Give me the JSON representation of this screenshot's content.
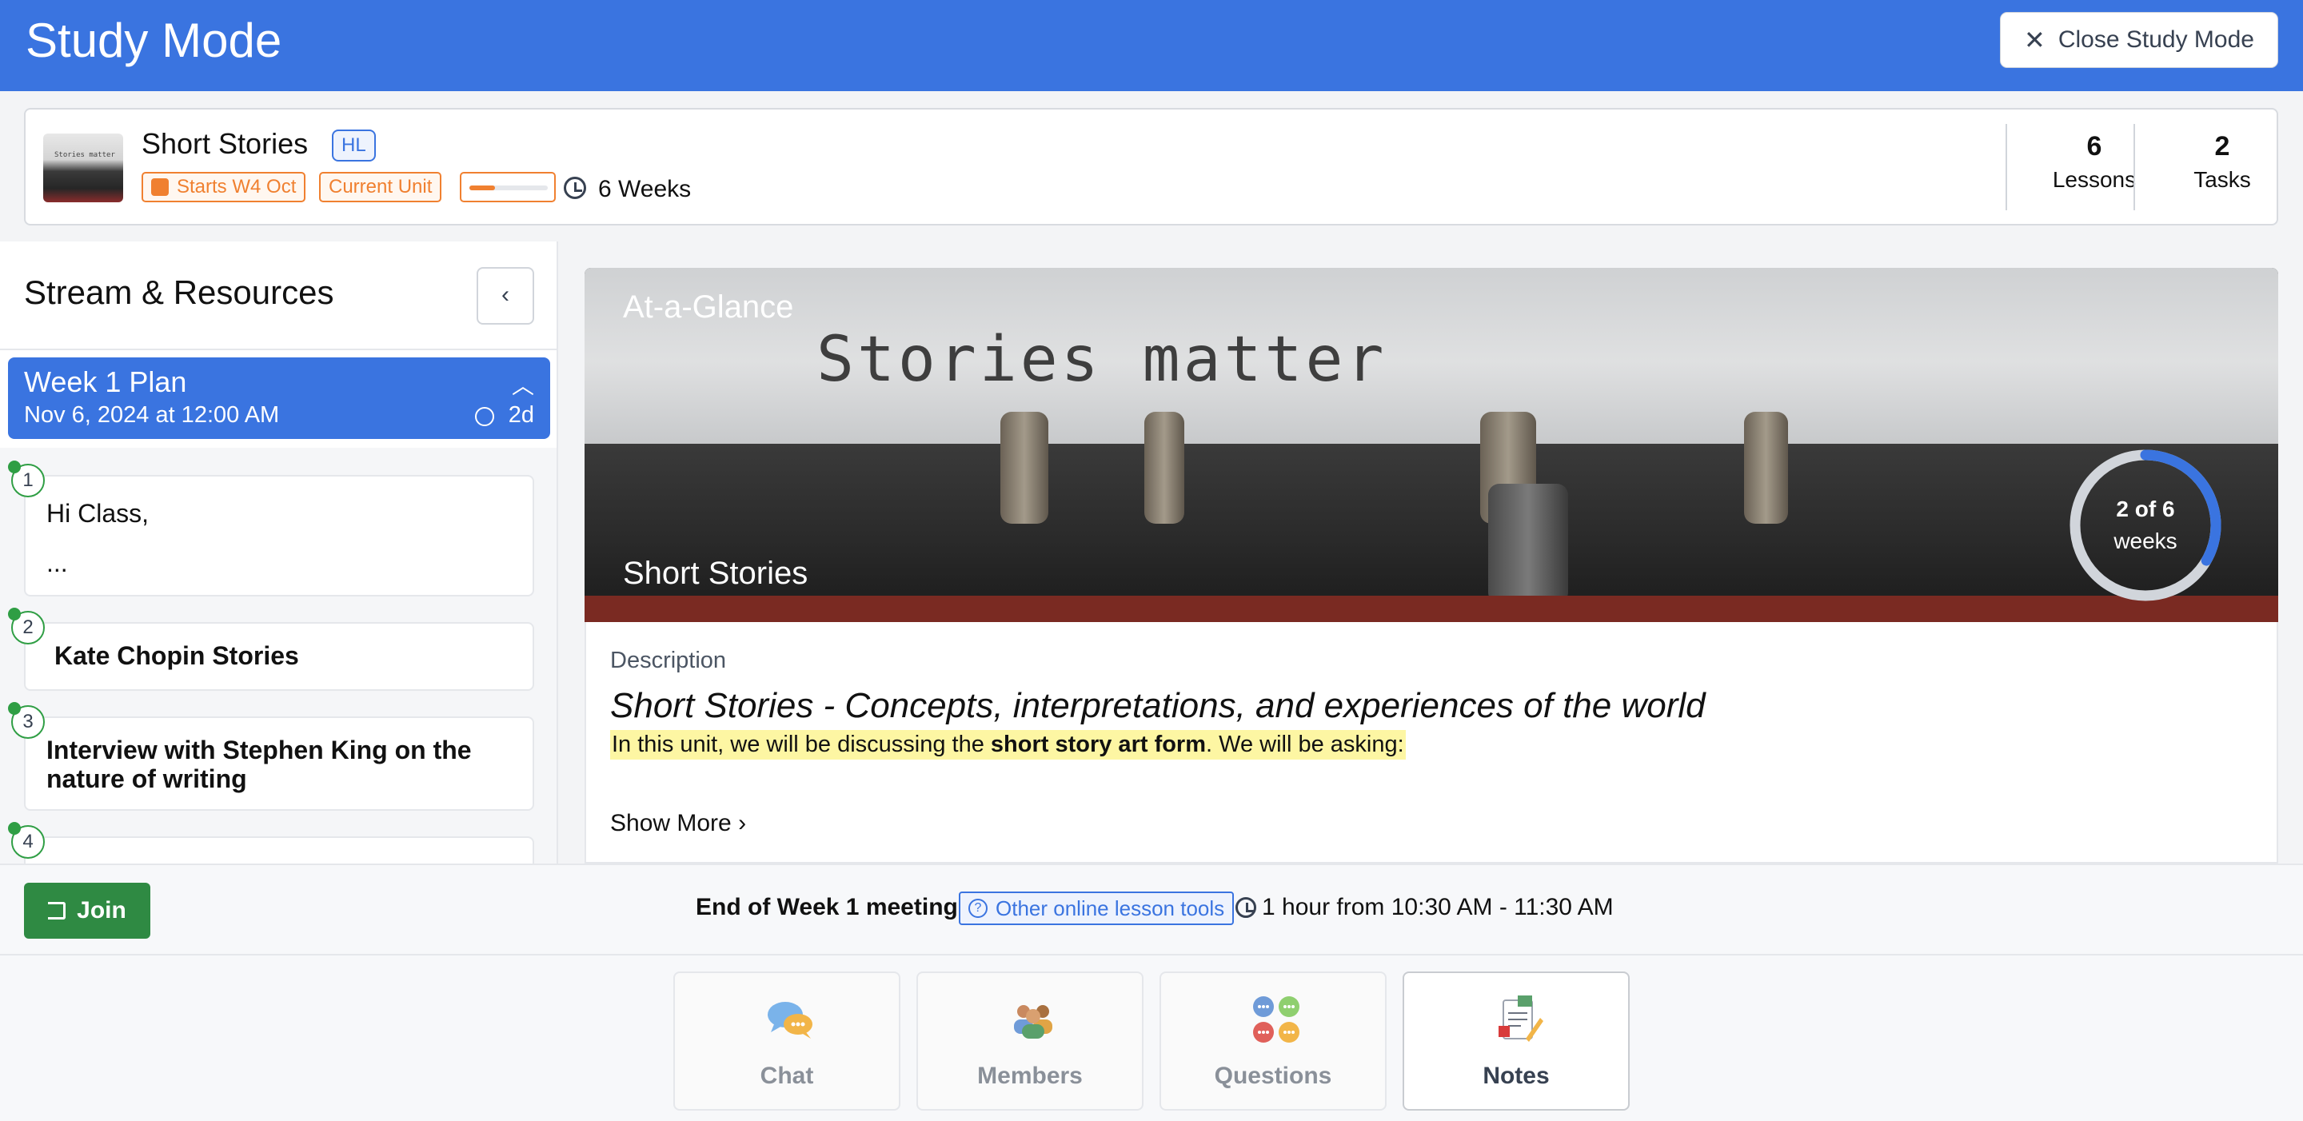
{
  "app": {
    "title": "Study Mode",
    "close_label": "Close Study Mode"
  },
  "unit": {
    "name": "Short Stories",
    "level": "HL",
    "starts": "Starts W4 Oct",
    "status": "Current Unit",
    "progress_fraction": 0.33,
    "duration": "6 Weeks",
    "stats": [
      {
        "value": "6",
        "label": "Lessons"
      },
      {
        "value": "2",
        "label": "Tasks"
      }
    ]
  },
  "sidebar": {
    "title": "Stream & Resources",
    "week_plan": {
      "title": "Week 1 Plan",
      "date": "Nov 6, 2024 at 12:00 AM",
      "due": "2d"
    },
    "items": [
      {
        "num": "1",
        "text_line1": "Hi Class,",
        "text_line2": "..."
      },
      {
        "num": "2",
        "text_line1": "Kate Chopin Stories"
      },
      {
        "num": "3",
        "text_line1": "Interview with Stephen King on the",
        "text_line2": "nature of writing"
      },
      {
        "num": "4"
      }
    ]
  },
  "hero": {
    "eyebrow": "At-a-Glance",
    "title": "Short Stories",
    "image_text": "Stories matter",
    "progress": {
      "current": 2,
      "total": 6,
      "line1": "2 of 6",
      "line2": "weeks"
    }
  },
  "description": {
    "label": "Description",
    "heading": "Short Stories - Concepts, interpretations, and experiences of the world",
    "body_pre": "In this unit, we will be discussing the ",
    "body_bold": "short story art form",
    "body_post": ". We will be asking:",
    "show_more": "Show More"
  },
  "meeting": {
    "join_label": "Join",
    "title": "End of Week 1 meeting",
    "tools_label": "Other online lesson tools",
    "time": "1 hour from 10:30 AM - 11:30 AM"
  },
  "tabs": [
    {
      "label": "Chat",
      "icon": "chat-icon"
    },
    {
      "label": "Members",
      "icon": "members-icon"
    },
    {
      "label": "Questions",
      "icon": "questions-icon"
    },
    {
      "label": "Notes",
      "icon": "notes-icon",
      "active": true
    }
  ],
  "colors": {
    "primary": "#3a74e0",
    "accent_orange": "#f08030",
    "success": "#2f8a43"
  }
}
